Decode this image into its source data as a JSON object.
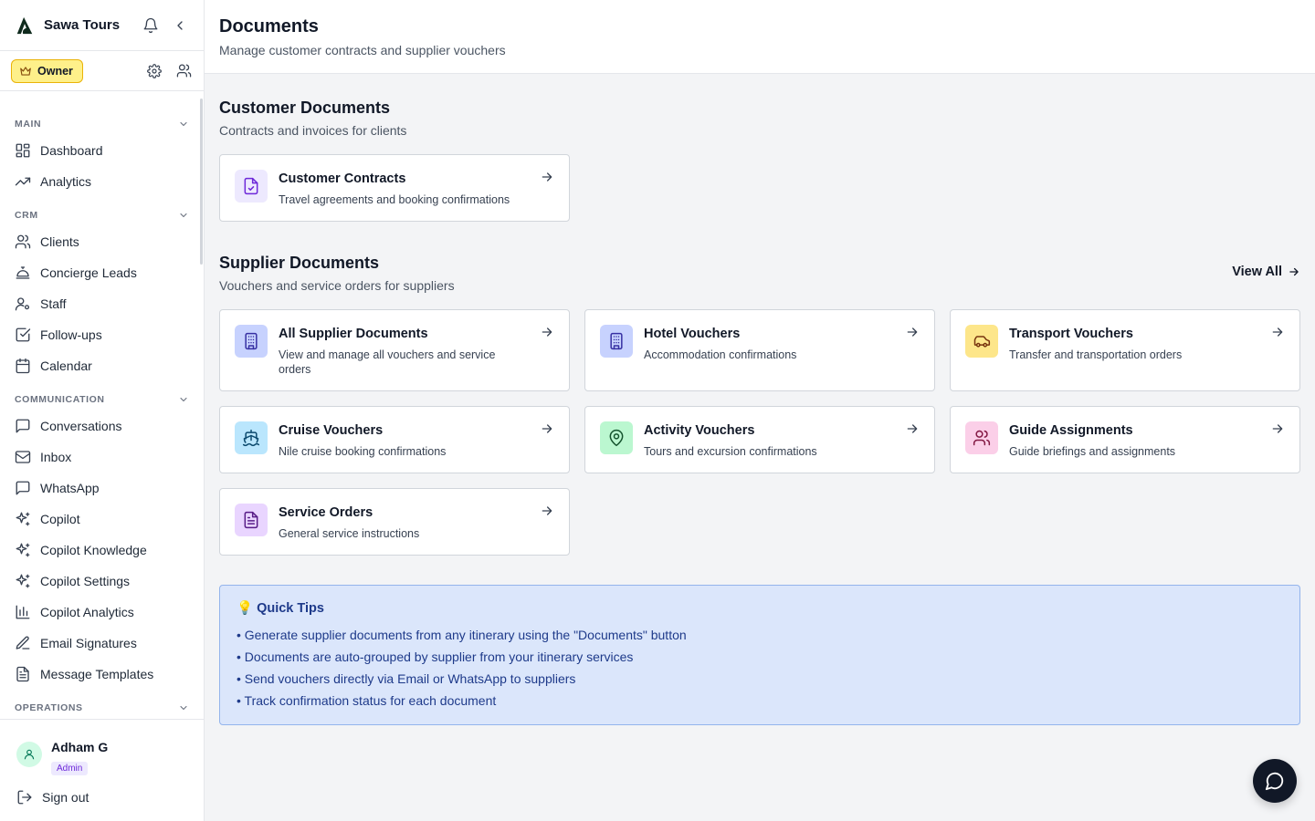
{
  "app": {
    "name": "Sawa Tours"
  },
  "role": {
    "label": "Owner"
  },
  "sidebar": {
    "sections": [
      {
        "title": "MAIN",
        "items": [
          {
            "label": "Dashboard",
            "icon": "dashboard-icon"
          },
          {
            "label": "Analytics",
            "icon": "trend-icon"
          }
        ]
      },
      {
        "title": "CRM",
        "items": [
          {
            "label": "Clients",
            "icon": "users-icon"
          },
          {
            "label": "Concierge Leads",
            "icon": "concierge-bell-icon"
          },
          {
            "label": "Staff",
            "icon": "user-cog-icon"
          },
          {
            "label": "Follow-ups",
            "icon": "checkbox-icon"
          },
          {
            "label": "Calendar",
            "icon": "calendar-icon"
          }
        ]
      },
      {
        "title": "COMMUNICATION",
        "items": [
          {
            "label": "Conversations",
            "icon": "message-square-icon"
          },
          {
            "label": "Inbox",
            "icon": "mail-icon"
          },
          {
            "label": "WhatsApp",
            "icon": "message-square-icon"
          },
          {
            "label": "Copilot",
            "icon": "sparkles-icon"
          },
          {
            "label": "Copilot Knowledge",
            "icon": "sparkles-icon"
          },
          {
            "label": "Copilot Settings",
            "icon": "sparkles-icon"
          },
          {
            "label": "Copilot Analytics",
            "icon": "bar-chart-icon"
          },
          {
            "label": "Email Signatures",
            "icon": "pen-icon"
          },
          {
            "label": "Message Templates",
            "icon": "file-text-icon"
          }
        ]
      },
      {
        "title": "OPERATIONS",
        "items": []
      }
    ]
  },
  "user": {
    "name": "Adham G",
    "badge": "Admin",
    "signout": "Sign out"
  },
  "page": {
    "title": "Documents",
    "subtitle": "Manage customer contracts and supplier vouchers"
  },
  "customer": {
    "title": "Customer Documents",
    "subtitle": "Contracts and invoices for clients",
    "cards": [
      {
        "title": "Customer Contracts",
        "desc": "Travel agreements and booking confirmations",
        "icon": "file-check-icon",
        "color": "#ede9fe",
        "iconColor": "#6d28d9"
      }
    ]
  },
  "supplier": {
    "title": "Supplier Documents",
    "subtitle": "Vouchers and service orders for suppliers",
    "view_all": "View All",
    "cards": [
      {
        "title": "All Supplier Documents",
        "desc": "View and manage all vouchers and service orders",
        "icon": "building-icon",
        "color": "#c7d2fe",
        "iconColor": "#3730a3"
      },
      {
        "title": "Hotel Vouchers",
        "desc": "Accommodation confirmations",
        "icon": "building-icon",
        "color": "#c7d2fe",
        "iconColor": "#3730a3"
      },
      {
        "title": "Transport Vouchers",
        "desc": "Transfer and transportation orders",
        "icon": "car-icon",
        "color": "#fde68a",
        "iconColor": "#78350f"
      },
      {
        "title": "Cruise Vouchers",
        "desc": "Nile cruise booking confirmations",
        "icon": "ship-icon",
        "color": "#bae6fd",
        "iconColor": "#0c4a6e"
      },
      {
        "title": "Activity Vouchers",
        "desc": "Tours and excursion confirmations",
        "icon": "map-pin-icon",
        "color": "#bbf7d0",
        "iconColor": "#14532d"
      },
      {
        "title": "Guide Assignments",
        "desc": "Guide briefings and assignments",
        "icon": "users-icon",
        "color": "#fbcfe8",
        "iconColor": "#831843"
      },
      {
        "title": "Service Orders",
        "desc": "General service instructions",
        "icon": "file-text-icon",
        "color": "#e9d5ff",
        "iconColor": "#581c87"
      }
    ]
  },
  "tips": {
    "title": "Quick Tips",
    "items": [
      "Generate supplier documents from any itinerary using the \"Documents\" button",
      "Documents are auto-grouped by supplier from your itinerary services",
      "Send vouchers directly via Email or WhatsApp to suppliers",
      "Track confirmation status for each document"
    ]
  }
}
